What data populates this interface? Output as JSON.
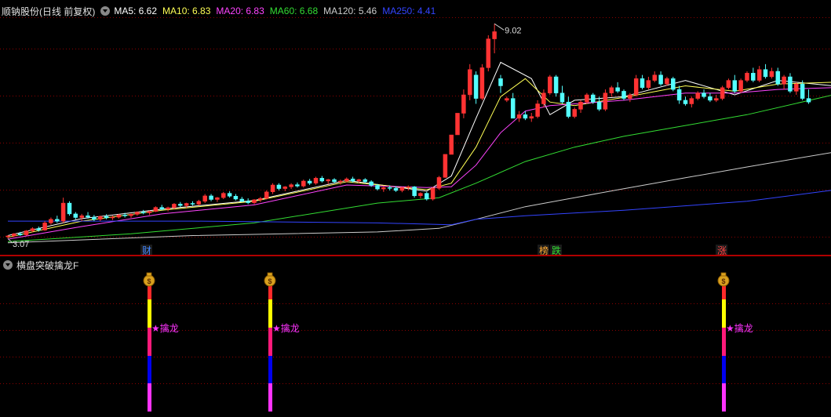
{
  "main_header": {
    "title": "顺钠股份(日线 前复权)",
    "ma_legend": [
      {
        "label": "MA5: 6.62",
        "color": "#ffffff"
      },
      {
        "label": "MA10: 6.83",
        "color": "#ffff55"
      },
      {
        "label": "MA20: 6.83",
        "color": "#ff44ff"
      },
      {
        "label": "MA60: 6.68",
        "color": "#33dd33"
      },
      {
        "label": "MA120: 5.46",
        "color": "#cccccc"
      },
      {
        "label": "MA250: 4.41",
        "color": "#3344ff"
      }
    ]
  },
  "price_labels": {
    "high": "9.02",
    "low": "3.07"
  },
  "event_markers": [
    {
      "text": "财",
      "color": "#4488ff"
    },
    {
      "text": "榜",
      "color": "#ffaa33"
    },
    {
      "text": "跌",
      "color": "#33dd33"
    },
    {
      "text": "涨",
      "color": "#ff4444"
    }
  ],
  "indicator": {
    "title": "横盘突破擒龙F",
    "signal_label": "★擒龙",
    "signal_icon": "money-bag-icon",
    "signal_count": 3
  },
  "colors": {
    "up": "#ff3333",
    "down": "#54ffff",
    "grid": "#8b0000",
    "divider": "#b00000"
  },
  "chart_data": {
    "type": "candlestick",
    "xlabel": "",
    "ylabel": "",
    "ylim": [
      2.9,
      9.2
    ],
    "candles": [
      [
        3.12,
        3.16,
        3.07,
        3.14
      ],
      [
        3.14,
        3.22,
        3.11,
        3.2
      ],
      [
        3.2,
        3.25,
        3.14,
        3.17
      ],
      [
        3.17,
        3.3,
        3.15,
        3.28
      ],
      [
        3.28,
        3.38,
        3.24,
        3.34
      ],
      [
        3.34,
        3.4,
        3.26,
        3.3
      ],
      [
        3.3,
        3.55,
        3.28,
        3.5
      ],
      [
        3.5,
        3.65,
        3.45,
        3.6
      ],
      [
        3.6,
        3.7,
        3.5,
        3.55
      ],
      [
        3.55,
        4.2,
        3.5,
        4.05
      ],
      [
        4.05,
        4.1,
        3.7,
        3.75
      ],
      [
        3.75,
        3.8,
        3.6,
        3.65
      ],
      [
        3.65,
        3.75,
        3.55,
        3.7
      ],
      [
        3.7,
        3.8,
        3.62,
        3.66
      ],
      [
        3.66,
        3.72,
        3.55,
        3.6
      ],
      [
        3.6,
        3.7,
        3.55,
        3.68
      ],
      [
        3.68,
        3.74,
        3.6,
        3.64
      ],
      [
        3.64,
        3.7,
        3.58,
        3.66
      ],
      [
        3.66,
        3.75,
        3.62,
        3.72
      ],
      [
        3.72,
        3.78,
        3.65,
        3.7
      ],
      [
        3.7,
        3.76,
        3.64,
        3.74
      ],
      [
        3.74,
        3.82,
        3.7,
        3.8
      ],
      [
        3.8,
        3.86,
        3.74,
        3.78
      ],
      [
        3.78,
        3.84,
        3.72,
        3.82
      ],
      [
        3.82,
        3.96,
        3.8,
        3.93
      ],
      [
        3.93,
        4.0,
        3.85,
        3.88
      ],
      [
        3.88,
        3.95,
        3.82,
        3.92
      ],
      [
        3.92,
        4.05,
        3.88,
        4.02
      ],
      [
        4.02,
        4.08,
        3.94,
        3.98
      ],
      [
        3.98,
        4.06,
        3.92,
        4.04
      ],
      [
        4.04,
        4.1,
        3.98,
        4.02
      ],
      [
        4.02,
        4.14,
        3.98,
        4.1
      ],
      [
        4.1,
        4.3,
        4.05,
        4.25
      ],
      [
        4.25,
        4.3,
        4.1,
        4.15
      ],
      [
        4.15,
        4.22,
        4.08,
        4.2
      ],
      [
        4.2,
        4.36,
        4.16,
        4.32
      ],
      [
        4.32,
        4.38,
        4.2,
        4.24
      ],
      [
        4.24,
        4.3,
        4.12,
        4.16
      ],
      [
        4.16,
        4.22,
        4.08,
        4.1
      ],
      [
        4.1,
        4.18,
        4.02,
        4.06
      ],
      [
        4.06,
        4.16,
        4.02,
        4.14
      ],
      [
        4.14,
        4.22,
        4.08,
        4.18
      ],
      [
        4.18,
        4.4,
        4.15,
        4.36
      ],
      [
        4.36,
        4.6,
        4.3,
        4.55
      ],
      [
        4.55,
        4.6,
        4.4,
        4.45
      ],
      [
        4.45,
        4.52,
        4.38,
        4.5
      ],
      [
        4.5,
        4.6,
        4.44,
        4.56
      ],
      [
        4.56,
        4.62,
        4.48,
        4.52
      ],
      [
        4.52,
        4.7,
        4.48,
        4.66
      ],
      [
        4.66,
        4.72,
        4.55,
        4.6
      ],
      [
        4.6,
        4.78,
        4.56,
        4.74
      ],
      [
        4.74,
        4.8,
        4.62,
        4.66
      ],
      [
        4.66,
        4.72,
        4.58,
        4.7
      ],
      [
        4.7,
        4.74,
        4.6,
        4.64
      ],
      [
        4.64,
        4.7,
        4.56,
        4.66
      ],
      [
        4.66,
        4.76,
        4.62,
        4.72
      ],
      [
        4.72,
        4.78,
        4.62,
        4.66
      ],
      [
        4.66,
        4.72,
        4.6,
        4.7
      ],
      [
        4.7,
        4.74,
        4.6,
        4.64
      ],
      [
        4.64,
        4.68,
        4.5,
        4.54
      ],
      [
        4.54,
        4.58,
        4.4,
        4.44
      ],
      [
        4.44,
        4.52,
        4.36,
        4.48
      ],
      [
        4.48,
        4.54,
        4.4,
        4.46
      ],
      [
        4.46,
        4.52,
        4.36,
        4.4
      ],
      [
        4.4,
        4.5,
        4.35,
        4.48
      ],
      [
        4.48,
        4.54,
        4.4,
        4.5
      ],
      [
        4.5,
        4.52,
        4.2,
        4.25
      ],
      [
        4.25,
        4.35,
        4.18,
        4.32
      ],
      [
        4.32,
        4.36,
        4.12,
        4.16
      ],
      [
        4.16,
        4.5,
        4.12,
        4.46
      ],
      [
        4.46,
        4.8,
        4.42,
        4.76
      ],
      [
        4.76,
        5.4,
        4.75,
        5.4
      ],
      [
        5.4,
        5.94,
        5.4,
        5.94
      ],
      [
        5.94,
        6.54,
        5.94,
        6.54
      ],
      [
        6.54,
        7.2,
        6.4,
        7.05
      ],
      [
        7.05,
        7.9,
        6.9,
        7.75
      ],
      [
        7.6,
        7.7,
        6.8,
        6.95
      ],
      [
        6.95,
        7.9,
        6.9,
        7.8
      ],
      [
        7.8,
        8.7,
        7.7,
        8.6
      ],
      [
        8.6,
        9.02,
        8.2,
        8.8
      ],
      [
        7.5,
        7.6,
        7.1,
        7.3
      ],
      [
        6.9,
        7.0,
        6.85,
        6.95
      ],
      [
        6.95,
        7.1,
        6.4,
        6.4
      ],
      [
        6.4,
        6.6,
        6.3,
        6.5
      ],
      [
        6.5,
        6.6,
        6.35,
        6.4
      ],
      [
        6.4,
        6.55,
        6.3,
        6.45
      ],
      [
        6.45,
        6.9,
        6.4,
        6.8
      ],
      [
        6.8,
        7.2,
        6.7,
        7.1
      ],
      [
        7.1,
        7.6,
        7.05,
        7.55
      ],
      [
        7.55,
        7.6,
        7.0,
        7.1
      ],
      [
        7.1,
        7.3,
        6.8,
        6.85
      ],
      [
        6.85,
        7.0,
        6.4,
        6.45
      ],
      [
        6.45,
        6.7,
        6.4,
        6.65
      ],
      [
        6.65,
        6.9,
        6.55,
        6.85
      ],
      [
        6.85,
        7.1,
        6.8,
        7.05
      ],
      [
        7.05,
        7.1,
        6.8,
        6.85
      ],
      [
        6.85,
        7.0,
        6.6,
        6.65
      ],
      [
        6.65,
        7.2,
        6.6,
        7.1
      ],
      [
        7.1,
        7.3,
        7.0,
        7.25
      ],
      [
        7.25,
        7.4,
        7.1,
        7.15
      ],
      [
        7.15,
        7.2,
        6.9,
        6.95
      ],
      [
        6.95,
        7.1,
        6.85,
        7.05
      ],
      [
        7.05,
        7.6,
        7.0,
        7.5
      ],
      [
        7.5,
        7.6,
        7.2,
        7.25
      ],
      [
        7.25,
        7.55,
        7.2,
        7.45
      ],
      [
        7.45,
        7.7,
        7.4,
        7.6
      ],
      [
        7.6,
        7.7,
        7.3,
        7.35
      ],
      [
        7.35,
        7.55,
        7.3,
        7.5
      ],
      [
        7.5,
        7.55,
        7.15,
        7.2
      ],
      [
        7.2,
        7.3,
        6.8,
        6.9
      ],
      [
        6.9,
        7.0,
        6.75,
        6.8
      ],
      [
        6.8,
        7.0,
        6.7,
        6.95
      ],
      [
        6.95,
        7.15,
        6.9,
        7.1
      ],
      [
        7.1,
        7.2,
        6.95,
        7.0
      ],
      [
        7.0,
        7.1,
        6.85,
        6.9
      ],
      [
        6.9,
        7.05,
        6.85,
        6.95
      ],
      [
        6.95,
        7.3,
        6.9,
        7.25
      ],
      [
        7.25,
        7.5,
        7.2,
        7.45
      ],
      [
        7.45,
        7.6,
        7.1,
        7.15
      ],
      [
        7.15,
        7.5,
        7.1,
        7.45
      ],
      [
        7.45,
        7.7,
        7.4,
        7.65
      ],
      [
        7.65,
        7.8,
        7.4,
        7.45
      ],
      [
        7.45,
        7.85,
        7.4,
        7.75
      ],
      [
        7.75,
        7.9,
        7.5,
        7.55
      ],
      [
        7.55,
        7.8,
        7.5,
        7.7
      ],
      [
        7.7,
        7.8,
        7.3,
        7.35
      ],
      [
        7.35,
        7.6,
        7.2,
        7.55
      ],
      [
        7.55,
        7.65,
        7.1,
        7.15
      ],
      [
        7.15,
        7.4,
        7.05,
        7.35
      ],
      [
        7.35,
        7.45,
        6.9,
        6.95
      ],
      [
        6.95,
        7.2,
        6.8,
        6.85
      ]
    ],
    "ma_lines": [
      {
        "name": "MA5",
        "color": "#ffffff",
        "pts": [
          [
            0,
            3.15
          ],
          [
            12,
            3.62
          ],
          [
            25,
            3.88
          ],
          [
            40,
            4.12
          ],
          [
            55,
            4.68
          ],
          [
            68,
            4.38
          ],
          [
            72,
            4.8
          ],
          [
            76,
            6.4
          ],
          [
            80,
            7.95
          ],
          [
            85,
            7.5
          ],
          [
            88,
            6.5
          ],
          [
            92,
            6.9
          ],
          [
            100,
            7.0
          ],
          [
            110,
            7.45
          ],
          [
            118,
            7.05
          ],
          [
            125,
            7.45
          ],
          [
            134,
            7.3
          ]
        ]
      },
      {
        "name": "MA10",
        "color": "#ffff55",
        "pts": [
          [
            0,
            3.1
          ],
          [
            12,
            3.55
          ],
          [
            25,
            3.85
          ],
          [
            40,
            4.1
          ],
          [
            55,
            4.64
          ],
          [
            68,
            4.42
          ],
          [
            72,
            4.6
          ],
          [
            76,
            5.6
          ],
          [
            80,
            7.0
          ],
          [
            84,
            7.5
          ],
          [
            88,
            6.85
          ],
          [
            92,
            6.75
          ],
          [
            100,
            6.98
          ],
          [
            110,
            7.3
          ],
          [
            118,
            7.15
          ],
          [
            125,
            7.35
          ],
          [
            134,
            7.4
          ]
        ]
      },
      {
        "name": "MA20",
        "color": "#ff44ff",
        "pts": [
          [
            0,
            3.05
          ],
          [
            12,
            3.4
          ],
          [
            25,
            3.75
          ],
          [
            40,
            4.0
          ],
          [
            55,
            4.55
          ],
          [
            68,
            4.48
          ],
          [
            72,
            4.5
          ],
          [
            76,
            5.1
          ],
          [
            80,
            6.0
          ],
          [
            84,
            6.6
          ],
          [
            88,
            6.75
          ],
          [
            92,
            6.8
          ],
          [
            100,
            6.9
          ],
          [
            110,
            7.1
          ],
          [
            118,
            7.1
          ],
          [
            125,
            7.2
          ],
          [
            134,
            7.25
          ]
        ]
      },
      {
        "name": "MA60",
        "color": "#33dd33",
        "pts": [
          [
            0,
            2.98
          ],
          [
            20,
            3.2
          ],
          [
            40,
            3.5
          ],
          [
            60,
            4.05
          ],
          [
            70,
            4.2
          ],
          [
            76,
            4.6
          ],
          [
            84,
            5.2
          ],
          [
            92,
            5.6
          ],
          [
            100,
            5.9
          ],
          [
            110,
            6.2
          ],
          [
            120,
            6.5
          ],
          [
            134,
            7.05
          ]
        ]
      },
      {
        "name": "MA120",
        "color": "#cccccc",
        "pts": [
          [
            0,
            2.95
          ],
          [
            30,
            3.15
          ],
          [
            60,
            3.25
          ],
          [
            70,
            3.35
          ],
          [
            76,
            3.6
          ],
          [
            84,
            3.95
          ],
          [
            92,
            4.2
          ],
          [
            100,
            4.45
          ],
          [
            110,
            4.75
          ],
          [
            120,
            5.05
          ],
          [
            134,
            5.46
          ]
        ]
      },
      {
        "name": "MA250",
        "color": "#3344ff",
        "pts": [
          [
            0,
            3.55
          ],
          [
            30,
            3.55
          ],
          [
            60,
            3.5
          ],
          [
            72,
            3.45
          ],
          [
            76,
            3.6
          ],
          [
            84,
            3.7
          ],
          [
            100,
            3.85
          ],
          [
            120,
            4.1
          ],
          [
            134,
            4.41
          ]
        ]
      }
    ]
  }
}
